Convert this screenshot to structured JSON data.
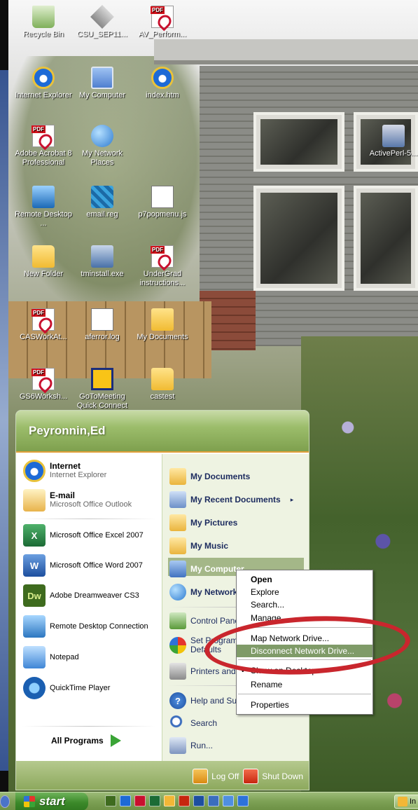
{
  "desktop": {
    "icons": [
      {
        "label": "Recycle Bin",
        "icon": "recycle-bin-icon"
      },
      {
        "label": "CSU_SEP11...",
        "icon": "package-icon"
      },
      {
        "label": "AV_Perform...",
        "icon": "pdf-icon"
      },
      {
        "label": "Internet Explorer",
        "icon": "internet-explorer-icon"
      },
      {
        "label": "My Computer",
        "icon": "my-computer-icon"
      },
      {
        "label": "index.htm",
        "icon": "internet-explorer-icon"
      },
      {
        "label": "Adobe Acrobat 8 Professional",
        "icon": "acrobat-icon"
      },
      {
        "label": "My Network Places",
        "icon": "network-places-icon"
      },
      {
        "label": "Remote Desktop ...",
        "icon": "remote-desktop-icon"
      },
      {
        "label": "email.reg",
        "icon": "registry-file-icon"
      },
      {
        "label": "p7popmenu.js",
        "icon": "script-file-icon"
      },
      {
        "label": "New Folder",
        "icon": "folder-icon"
      },
      {
        "label": "tminstall.exe",
        "icon": "installer-icon"
      },
      {
        "label": "UnderGrad instructions...",
        "icon": "pdf-icon"
      },
      {
        "label": "CASWorkAt...",
        "icon": "pdf-icon"
      },
      {
        "label": "aferror.log",
        "icon": "text-file-icon"
      },
      {
        "label": "My Documents",
        "icon": "my-documents-icon"
      },
      {
        "label": "GS6Worksh...",
        "icon": "pdf-icon"
      },
      {
        "label": "GoToMeeting Quick Connect",
        "icon": "gotomeeting-icon"
      },
      {
        "label": "castest",
        "icon": "folder-icon"
      },
      {
        "label": "ActivePerl-5...",
        "icon": "installer-icon"
      }
    ]
  },
  "start_menu": {
    "user_name": "Peyronnin,Ed",
    "pinned": [
      {
        "title": "Internet",
        "subtitle": "Internet Explorer"
      },
      {
        "title": "E-mail",
        "subtitle": "Microsoft Office Outlook"
      }
    ],
    "recent": [
      {
        "label": "Microsoft Office Excel 2007",
        "badge": "X"
      },
      {
        "label": "Microsoft Office Word 2007",
        "badge": "W"
      },
      {
        "label": "Adobe Dreamweaver CS3",
        "badge": "Dw"
      },
      {
        "label": "Remote Desktop Connection"
      },
      {
        "label": "Notepad"
      },
      {
        "label": "QuickTime Player"
      }
    ],
    "all_programs": "All Programs",
    "places": [
      {
        "label": "My Documents"
      },
      {
        "label": "My Recent Documents",
        "arrow": "▸"
      },
      {
        "label": "My Pictures"
      },
      {
        "label": "My Music"
      },
      {
        "label": "My Computer"
      },
      {
        "label": "My Network Places"
      }
    ],
    "system": [
      {
        "label": "Control Panel"
      },
      {
        "label": "Set Program Access and Defaults"
      },
      {
        "label": "Printers and Faxes"
      },
      {
        "label": "Help and Support"
      },
      {
        "label": "Search"
      },
      {
        "label": "Run..."
      }
    ],
    "log_off": "Log Off",
    "shut_down": "Shut Down"
  },
  "context_menu": {
    "items": [
      "Open",
      "Explore",
      "Search...",
      "Manage",
      "Map Network Drive...",
      "Disconnect Network Drive...",
      "Show on Desktop",
      "Rename",
      "Properties"
    ],
    "selected": "Disconnect Network Drive...",
    "checked": "Show on Desktop"
  },
  "taskbar": {
    "start_label": "start",
    "task_label": "In"
  },
  "colors": {
    "start_header": "#9cbd6b",
    "highlight": "#7f9b68",
    "annotation": "#c9262d"
  }
}
